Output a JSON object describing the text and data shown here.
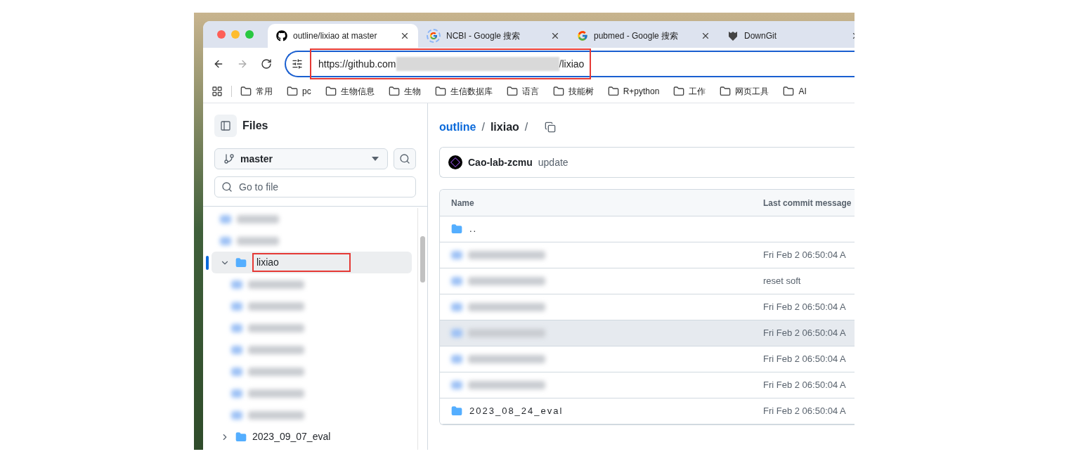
{
  "browser": {
    "tabs": [
      {
        "title": "outline/lixiao at master",
        "selected": true,
        "kind": "github"
      },
      {
        "title": "NCBI - Google 搜索",
        "selected": false,
        "kind": "loading"
      },
      {
        "title": "pubmed - Google 搜索",
        "selected": false,
        "kind": "google"
      },
      {
        "title": "DownGit",
        "selected": false,
        "kind": "shield"
      }
    ],
    "url": {
      "start": "https://github.com",
      "end": "/lixiao"
    },
    "bookmarks": [
      "常用",
      "pc",
      "生物信息",
      "生物",
      "生信数据库",
      "语言",
      "技能树",
      "R+python",
      "工作",
      "网页工具",
      "AI"
    ]
  },
  "sidebar": {
    "title": "Files",
    "branch": "master",
    "search": {
      "placeholder": "Go to file"
    },
    "tree": [
      {
        "kind": "redacted",
        "selected": false
      },
      {
        "kind": "redacted",
        "selected": false
      },
      {
        "kind": "folder",
        "label": "lixiao",
        "selected": true,
        "expanded": true,
        "children": [
          {
            "kind": "redacted",
            "selected": false
          },
          {
            "kind": "redacted",
            "selected": false
          },
          {
            "kind": "redacted",
            "selected": false
          },
          {
            "kind": "redacted",
            "selected": false
          },
          {
            "kind": "redacted",
            "selected": false
          },
          {
            "kind": "redacted",
            "selected": false
          },
          {
            "kind": "redacted",
            "selected": false
          }
        ]
      },
      {
        "kind": "folder",
        "label": "2023_09_07_eval",
        "selected": false,
        "expanded": false
      }
    ]
  },
  "main": {
    "breadcrumb": [
      {
        "label": "outline",
        "link": true,
        "separator": "/"
      },
      {
        "label": "lixiao",
        "link": false,
        "separator": "/"
      }
    ],
    "commit": {
      "author": "Cao-lab-zcmu",
      "message": "update"
    },
    "table": {
      "columns": [
        "Name",
        "Last commit message"
      ],
      "rows": [
        {
          "kind": "parent",
          "name": "..",
          "hovered": false
        },
        {
          "kind": "redacted",
          "message": "Fri Feb 2 06:50:04 A",
          "hovered": false
        },
        {
          "kind": "redacted",
          "message": "reset soft",
          "hovered": false
        },
        {
          "kind": "redacted",
          "message": "Fri Feb 2 06:50:04 A",
          "hovered": false
        },
        {
          "kind": "redacted",
          "message": "Fri Feb 2 06:50:04 A",
          "hovered": true
        },
        {
          "kind": "redacted",
          "message": "Fri Feb 2 06:50:04 A",
          "hovered": false
        },
        {
          "kind": "redacted",
          "message": "Fri Feb 2 06:50:04 A",
          "hovered": false
        },
        {
          "kind": "folder",
          "name": "2023_08_24_eval",
          "message": "Fri Feb 2 06:50:04 A",
          "hovered": false
        }
      ]
    }
  }
}
